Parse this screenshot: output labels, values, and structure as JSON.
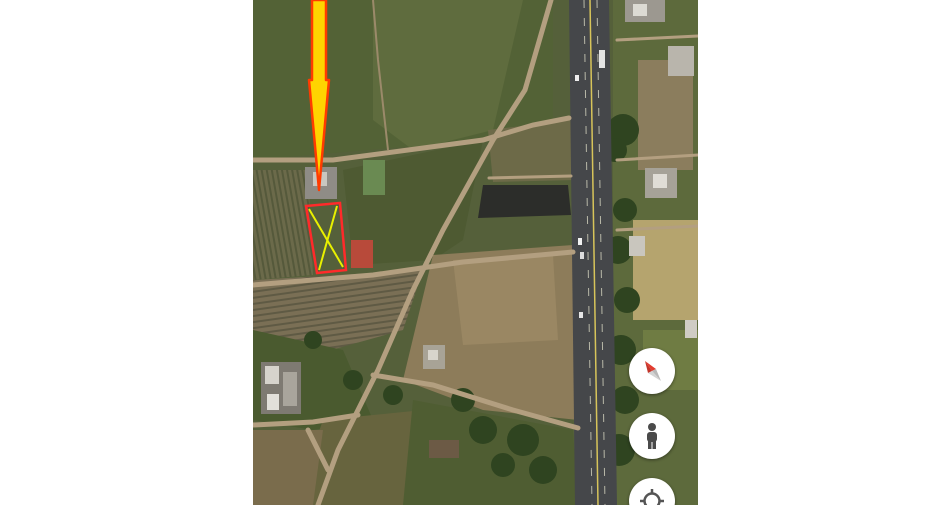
{
  "map": {
    "view": "satellite",
    "markers": {
      "arrow": {
        "color": "#ffd400",
        "outline": "#ff3b00"
      },
      "plot": {
        "outline": "#ff2a2a",
        "cross": "#e8f000"
      }
    }
  },
  "controls": [
    {
      "id": "compass",
      "icon": "compass-icon"
    },
    {
      "id": "street-view",
      "icon": "pegman-icon"
    },
    {
      "id": "my-location",
      "icon": "crosshair-icon"
    }
  ],
  "colors": {
    "road": "#45474a",
    "dirt_path": "#b39f80",
    "field_dark": "#4f5a33",
    "field_light": "#8a7e5e",
    "button_bg": "#ffffff"
  }
}
